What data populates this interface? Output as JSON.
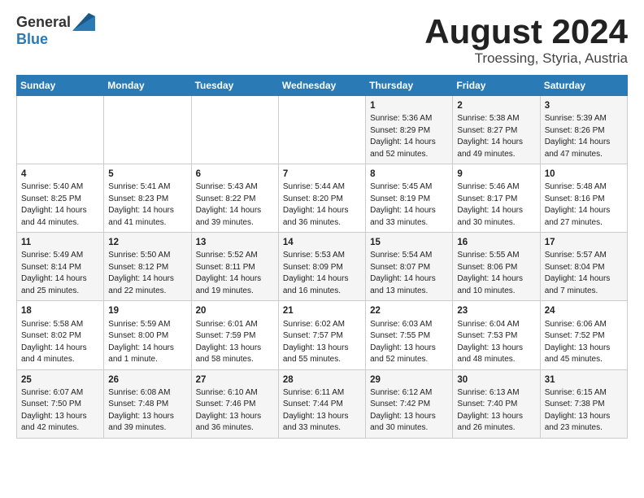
{
  "header": {
    "logo_general": "General",
    "logo_blue": "Blue",
    "month_title": "August 2024",
    "location": "Troessing, Styria, Austria"
  },
  "weekdays": [
    "Sunday",
    "Monday",
    "Tuesday",
    "Wednesday",
    "Thursday",
    "Friday",
    "Saturday"
  ],
  "weeks": [
    [
      {
        "day": "",
        "info": ""
      },
      {
        "day": "",
        "info": ""
      },
      {
        "day": "",
        "info": ""
      },
      {
        "day": "",
        "info": ""
      },
      {
        "day": "1",
        "info": "Sunrise: 5:36 AM\nSunset: 8:29 PM\nDaylight: 14 hours\nand 52 minutes."
      },
      {
        "day": "2",
        "info": "Sunrise: 5:38 AM\nSunset: 8:27 PM\nDaylight: 14 hours\nand 49 minutes."
      },
      {
        "day": "3",
        "info": "Sunrise: 5:39 AM\nSunset: 8:26 PM\nDaylight: 14 hours\nand 47 minutes."
      }
    ],
    [
      {
        "day": "4",
        "info": "Sunrise: 5:40 AM\nSunset: 8:25 PM\nDaylight: 14 hours\nand 44 minutes."
      },
      {
        "day": "5",
        "info": "Sunrise: 5:41 AM\nSunset: 8:23 PM\nDaylight: 14 hours\nand 41 minutes."
      },
      {
        "day": "6",
        "info": "Sunrise: 5:43 AM\nSunset: 8:22 PM\nDaylight: 14 hours\nand 39 minutes."
      },
      {
        "day": "7",
        "info": "Sunrise: 5:44 AM\nSunset: 8:20 PM\nDaylight: 14 hours\nand 36 minutes."
      },
      {
        "day": "8",
        "info": "Sunrise: 5:45 AM\nSunset: 8:19 PM\nDaylight: 14 hours\nand 33 minutes."
      },
      {
        "day": "9",
        "info": "Sunrise: 5:46 AM\nSunset: 8:17 PM\nDaylight: 14 hours\nand 30 minutes."
      },
      {
        "day": "10",
        "info": "Sunrise: 5:48 AM\nSunset: 8:16 PM\nDaylight: 14 hours\nand 27 minutes."
      }
    ],
    [
      {
        "day": "11",
        "info": "Sunrise: 5:49 AM\nSunset: 8:14 PM\nDaylight: 14 hours\nand 25 minutes."
      },
      {
        "day": "12",
        "info": "Sunrise: 5:50 AM\nSunset: 8:12 PM\nDaylight: 14 hours\nand 22 minutes."
      },
      {
        "day": "13",
        "info": "Sunrise: 5:52 AM\nSunset: 8:11 PM\nDaylight: 14 hours\nand 19 minutes."
      },
      {
        "day": "14",
        "info": "Sunrise: 5:53 AM\nSunset: 8:09 PM\nDaylight: 14 hours\nand 16 minutes."
      },
      {
        "day": "15",
        "info": "Sunrise: 5:54 AM\nSunset: 8:07 PM\nDaylight: 14 hours\nand 13 minutes."
      },
      {
        "day": "16",
        "info": "Sunrise: 5:55 AM\nSunset: 8:06 PM\nDaylight: 14 hours\nand 10 minutes."
      },
      {
        "day": "17",
        "info": "Sunrise: 5:57 AM\nSunset: 8:04 PM\nDaylight: 14 hours\nand 7 minutes."
      }
    ],
    [
      {
        "day": "18",
        "info": "Sunrise: 5:58 AM\nSunset: 8:02 PM\nDaylight: 14 hours\nand 4 minutes."
      },
      {
        "day": "19",
        "info": "Sunrise: 5:59 AM\nSunset: 8:00 PM\nDaylight: 14 hours\nand 1 minute."
      },
      {
        "day": "20",
        "info": "Sunrise: 6:01 AM\nSunset: 7:59 PM\nDaylight: 13 hours\nand 58 minutes."
      },
      {
        "day": "21",
        "info": "Sunrise: 6:02 AM\nSunset: 7:57 PM\nDaylight: 13 hours\nand 55 minutes."
      },
      {
        "day": "22",
        "info": "Sunrise: 6:03 AM\nSunset: 7:55 PM\nDaylight: 13 hours\nand 52 minutes."
      },
      {
        "day": "23",
        "info": "Sunrise: 6:04 AM\nSunset: 7:53 PM\nDaylight: 13 hours\nand 48 minutes."
      },
      {
        "day": "24",
        "info": "Sunrise: 6:06 AM\nSunset: 7:52 PM\nDaylight: 13 hours\nand 45 minutes."
      }
    ],
    [
      {
        "day": "25",
        "info": "Sunrise: 6:07 AM\nSunset: 7:50 PM\nDaylight: 13 hours\nand 42 minutes."
      },
      {
        "day": "26",
        "info": "Sunrise: 6:08 AM\nSunset: 7:48 PM\nDaylight: 13 hours\nand 39 minutes."
      },
      {
        "day": "27",
        "info": "Sunrise: 6:10 AM\nSunset: 7:46 PM\nDaylight: 13 hours\nand 36 minutes."
      },
      {
        "day": "28",
        "info": "Sunrise: 6:11 AM\nSunset: 7:44 PM\nDaylight: 13 hours\nand 33 minutes."
      },
      {
        "day": "29",
        "info": "Sunrise: 6:12 AM\nSunset: 7:42 PM\nDaylight: 13 hours\nand 30 minutes."
      },
      {
        "day": "30",
        "info": "Sunrise: 6:13 AM\nSunset: 7:40 PM\nDaylight: 13 hours\nand 26 minutes."
      },
      {
        "day": "31",
        "info": "Sunrise: 6:15 AM\nSunset: 7:38 PM\nDaylight: 13 hours\nand 23 minutes."
      }
    ]
  ]
}
